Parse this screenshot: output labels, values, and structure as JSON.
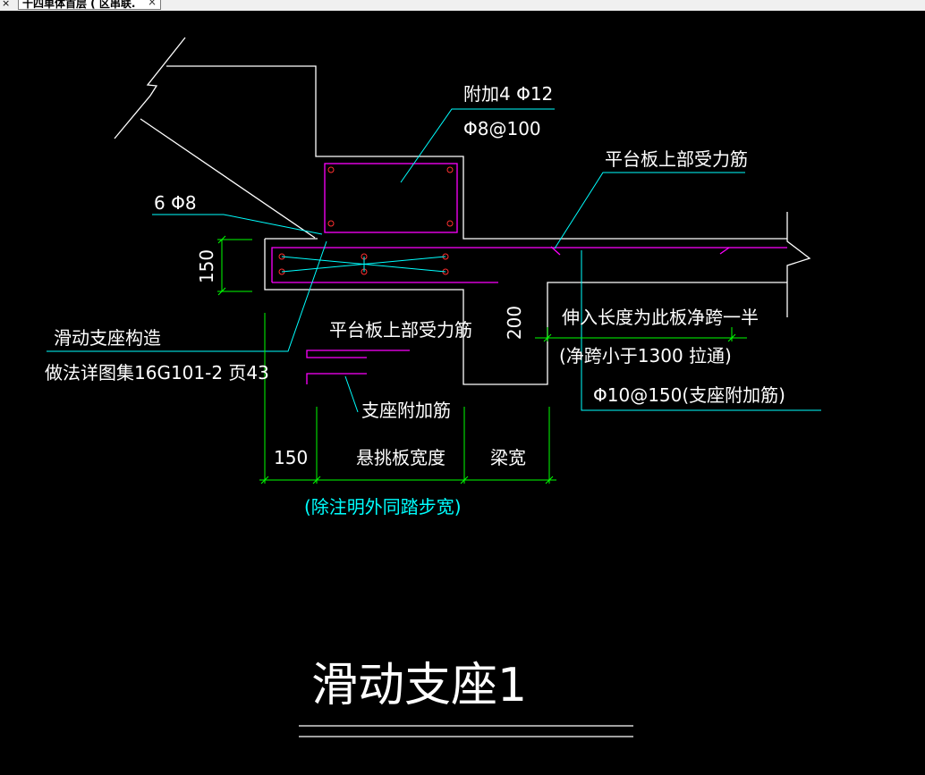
{
  "tab": {
    "label": "十四单体首层 ( 区串联.",
    "close": "×",
    "menu": "×"
  },
  "labels": {
    "extra_bars": "附加4 Φ12",
    "stirrup": "Φ8@100",
    "platform_top_bars": "平台板上部受力筋",
    "bars_6": "6 Φ8",
    "dim_150_v": "150",
    "sliding_detail": "滑动支座构造",
    "reference": "做法详图集16G101-2 页43",
    "platform_top_bars_2": "平台板上部受力筋",
    "dim_200": "200",
    "extend_length": "伸入长度为此板净跨一半",
    "net_span": "(净跨小于1300 拉通)",
    "support_bars": "Φ10@150(支座附加筋)",
    "support_extra": "支座附加筋",
    "dim_150_h": "150",
    "cantilever_width": "悬挑板宽度",
    "beam_width": "梁宽",
    "note": "(除注明外同踏步宽)",
    "title": "滑动支座1"
  },
  "colors": {
    "outline": "#ffffff",
    "rebar": "#ff00ff",
    "leader": "#00ffff",
    "dim": "#00ff00",
    "dot": "#ff3030",
    "note": "#00ffff"
  }
}
